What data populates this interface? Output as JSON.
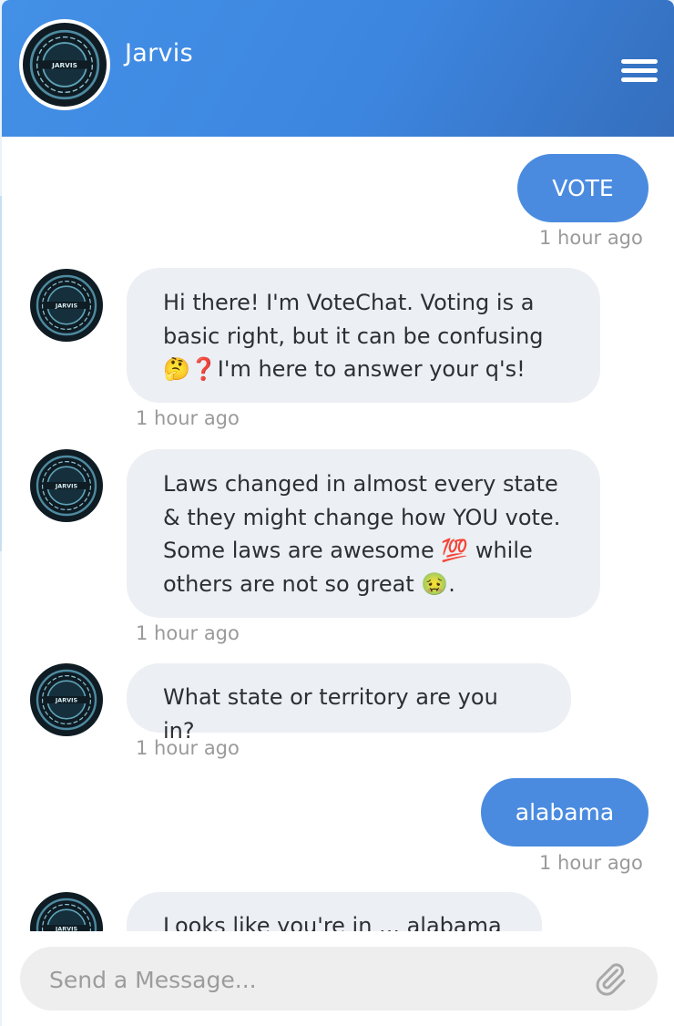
{
  "header": {
    "title": "Jarvis",
    "avatar_text": "JARVIS",
    "menu_icon": "hamburger-menu-icon"
  },
  "messages": [
    {
      "from": "user",
      "text": "VOTE",
      "time": "1 hour ago"
    },
    {
      "from": "bot",
      "text": "Hi there! I'm VoteChat. Voting is a basic right, but it can be confusing 🤔❓I'm here to answer your q's!",
      "time": "1 hour ago"
    },
    {
      "from": "bot",
      "text": "Laws changed in almost every state & they might change how YOU vote. Some laws are awesome 💯 while others are not so great 🤢.",
      "time": "1 hour ago"
    },
    {
      "from": "bot",
      "text": "What state or territory are you in?",
      "time": "1 hour ago"
    },
    {
      "from": "user",
      "text": "alabama",
      "time": "1 hour ago"
    },
    {
      "from": "bot",
      "text": "Looks like you're in ... alabama",
      "time": ""
    }
  ],
  "composer": {
    "placeholder": "Send a Message...",
    "attach_icon": "paperclip-icon"
  },
  "colors": {
    "header_start": "#4390e6",
    "header_end": "#356ebd",
    "user_bubble": "#4a8be0",
    "bot_bubble": "#eceff3",
    "timestamp": "#9a9a9a"
  }
}
